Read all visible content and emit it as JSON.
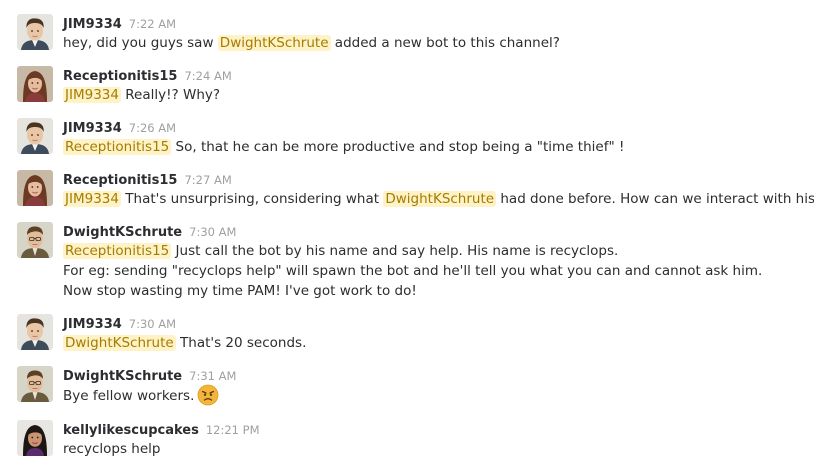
{
  "colors": {
    "mention_bg": "#fef2c7",
    "mention_text": "#a67c00",
    "timestamp": "#a0a0a2",
    "text": "#2c2d30"
  },
  "messages": [
    {
      "author": "JIM9334",
      "time": "7:22 AM",
      "avatar": "jim-avatar-icon",
      "lines": [
        {
          "text1": "hey, did you guys saw ",
          "mention": "DwightKSchrute",
          "text2": " added a new bot to this channel?"
        }
      ]
    },
    {
      "author": "Receptionitis15",
      "time": "7:24 AM",
      "avatar": "pam-avatar-icon",
      "lines": [
        {
          "mention": "JIM9334",
          "text2": " Really!? Why?"
        }
      ]
    },
    {
      "author": "JIM9334",
      "time": "7:26 AM",
      "avatar": "jim-avatar-icon",
      "lines": [
        {
          "mention": "Receptionitis15",
          "text2": " So, that he can be more productive and stop being a \"time thief\" !"
        }
      ]
    },
    {
      "author": "Receptionitis15",
      "time": "7:27 AM",
      "avatar": "pam-avatar-icon",
      "lines": [
        {
          "mention": "JIM9334",
          "text2": " That's unsurprising, considering what ",
          "mention2": "DwightKSchrute",
          "text3": " had done before. How can we interact with his bot?"
        }
      ]
    },
    {
      "author": "DwightKSchrute",
      "time": "7:30 AM",
      "avatar": "dwight-avatar-icon",
      "lines": [
        {
          "mention": "Receptionitis15",
          "text2": " Just call the bot by his name and say help. His name is recyclops."
        },
        {
          "text1": "For eg: sending \"recyclops help\" will spawn the bot and he'll tell you what you can and cannot ask him."
        },
        {
          "text1": "Now stop wasting my time PAM! I've got work to do!"
        }
      ]
    },
    {
      "author": "JIM9334",
      "time": "7:30 AM",
      "avatar": "jim-avatar-icon",
      "lines": [
        {
          "mention": "DwightKSchrute",
          "text2": " That's 20 seconds."
        }
      ]
    },
    {
      "author": "DwightKSchrute",
      "time": "7:31 AM",
      "avatar": "dwight-avatar-icon",
      "lines": [
        {
          "text1": "Bye fellow workers.",
          "emoji": "angry-face-icon"
        }
      ]
    },
    {
      "author": "kellylikescupcakes",
      "time": "12:21 PM",
      "avatar": "kelly-avatar-icon",
      "lines": [
        {
          "text1": "recyclops help"
        }
      ]
    }
  ]
}
